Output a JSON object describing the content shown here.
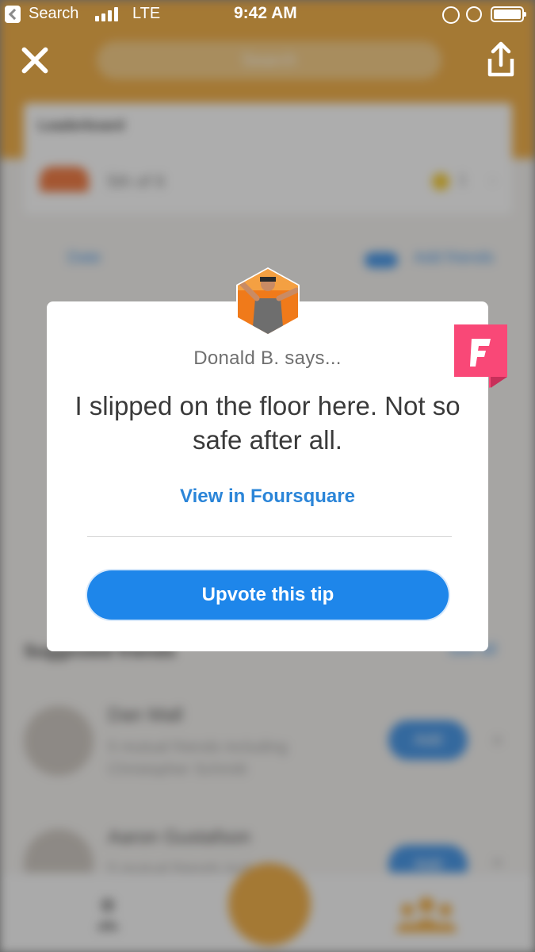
{
  "status_bar": {
    "back_label": "Search",
    "carrier": "LTE",
    "time": "9:42 AM"
  },
  "background": {
    "search_placeholder": "Search",
    "leaderboard_title": "Leaderboard",
    "leaderboard_rank": "5th of 6",
    "leaderboard_coins": "1",
    "filter_label": "Date",
    "add_friends_label": "Add friends",
    "suggested_title": "Suggested friends",
    "see_all_label": "See all",
    "suggestions": [
      {
        "name": "Dan Mall",
        "mutual": "5 mutual friends including Christopher Schmitt",
        "add_label": "Add"
      },
      {
        "name": "Aaron Gustafson",
        "mutual": "5 mutual friends including",
        "add_label": "Add"
      }
    ]
  },
  "tip_modal": {
    "author": "Donald B. says...",
    "text": "I slipped on the floor here. Not so safe after all.",
    "view_link": "View in Foursquare",
    "upvote_button": "Upvote this tip",
    "badge_color": "#f94877",
    "button_color": "#1e86ea"
  },
  "colors": {
    "header_accent": "#f0a530",
    "link_blue": "#2b85d8"
  }
}
